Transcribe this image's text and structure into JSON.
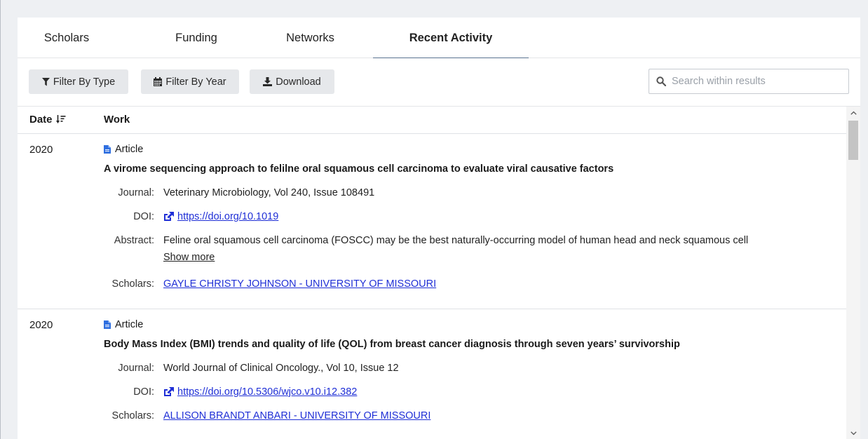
{
  "tabs": [
    {
      "label": "Scholars"
    },
    {
      "label": "Funding"
    },
    {
      "label": "Networks"
    },
    {
      "label": "Recent Activity",
      "active": true
    }
  ],
  "toolbar": {
    "filter_type_label": "Filter By Type",
    "filter_year_label": "Filter By Year",
    "download_label": "Download",
    "search_placeholder": "Search within results"
  },
  "table": {
    "headers": {
      "date": "Date",
      "work": "Work"
    },
    "rows": [
      {
        "year": "2020",
        "type": "Article",
        "title": "A virome sequencing approach to felilne oral squamous cell carcinoma to evaluate viral causative factors",
        "journal_label": "Journal:",
        "journal": "Veterinary Microbiology, Vol 240, Issue 108491",
        "doi_label": "DOI:",
        "doi": "https://doi.org/10.1019",
        "abstract_label": "Abstract:",
        "abstract": "Feline oral squamous cell carcinoma (FOSCC) may be the best naturally-occurring model of human head and neck squamous cell",
        "show_more": "Show more",
        "scholars_label": "Scholars:",
        "scholars": "GAYLE CHRISTY JOHNSON - UNIVERSITY OF MISSOURI"
      },
      {
        "year": "2020",
        "type": "Article",
        "title": "Body Mass Index (BMI) trends and quality of life (QOL) from breast cancer diagnosis through seven years’ survivorship",
        "journal_label": "Journal:",
        "journal": "World Journal of Clinical Oncology., Vol 10, Issue 12",
        "doi_label": "DOI:",
        "doi": "https://doi.org/10.5306/wjco.v10.i12.382",
        "scholars_label": "Scholars:",
        "scholars": "ALLISON BRANDT ANBARI - UNIVERSITY OF MISSOURI"
      }
    ]
  },
  "colors": {
    "link": "#1f2fd6",
    "article_icon": "#2f6fe0",
    "active_tab_underline": "#5a7391"
  },
  "icons": {
    "filter_type": "filter-icon",
    "filter_year": "calendar-icon",
    "download": "download-icon",
    "search": "search-icon",
    "sort": "sort-desc-icon",
    "article": "file-icon",
    "doi": "external-link-icon"
  }
}
